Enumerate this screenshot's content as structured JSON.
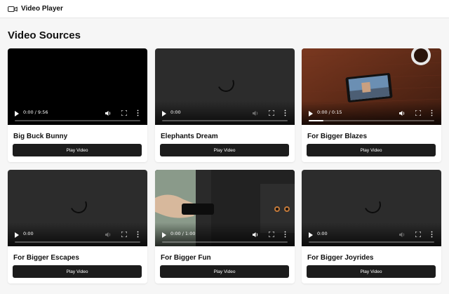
{
  "app": {
    "title": "Video Player",
    "icon": "video-camera-icon"
  },
  "page": {
    "heading": "Video Sources"
  },
  "videos": [
    {
      "title": "Big Buck Bunny",
      "time": "0:00 / 9:56",
      "button": "Play Video",
      "progress": 0
    },
    {
      "title": "Elephants Dream",
      "time": "0:00",
      "button": "Play Video",
      "progress": 0
    },
    {
      "title": "For Bigger Blazes",
      "time": "0:00 / 0:15",
      "button": "Play Video",
      "progress": 0.12
    },
    {
      "title": "For Bigger Escapes",
      "time": "0:00",
      "button": "Play Video",
      "progress": 0
    },
    {
      "title": "For Bigger Fun",
      "time": "0:00 / 1:00",
      "button": "Play Video",
      "progress": 0
    },
    {
      "title": "For Bigger Joyrides",
      "time": "0:00",
      "button": "Play Video",
      "progress": 0
    }
  ],
  "colors": {
    "page_bg": "#f6f6f6",
    "button_bg": "#1c1c1c",
    "video_bg": "#2c2c2c"
  }
}
